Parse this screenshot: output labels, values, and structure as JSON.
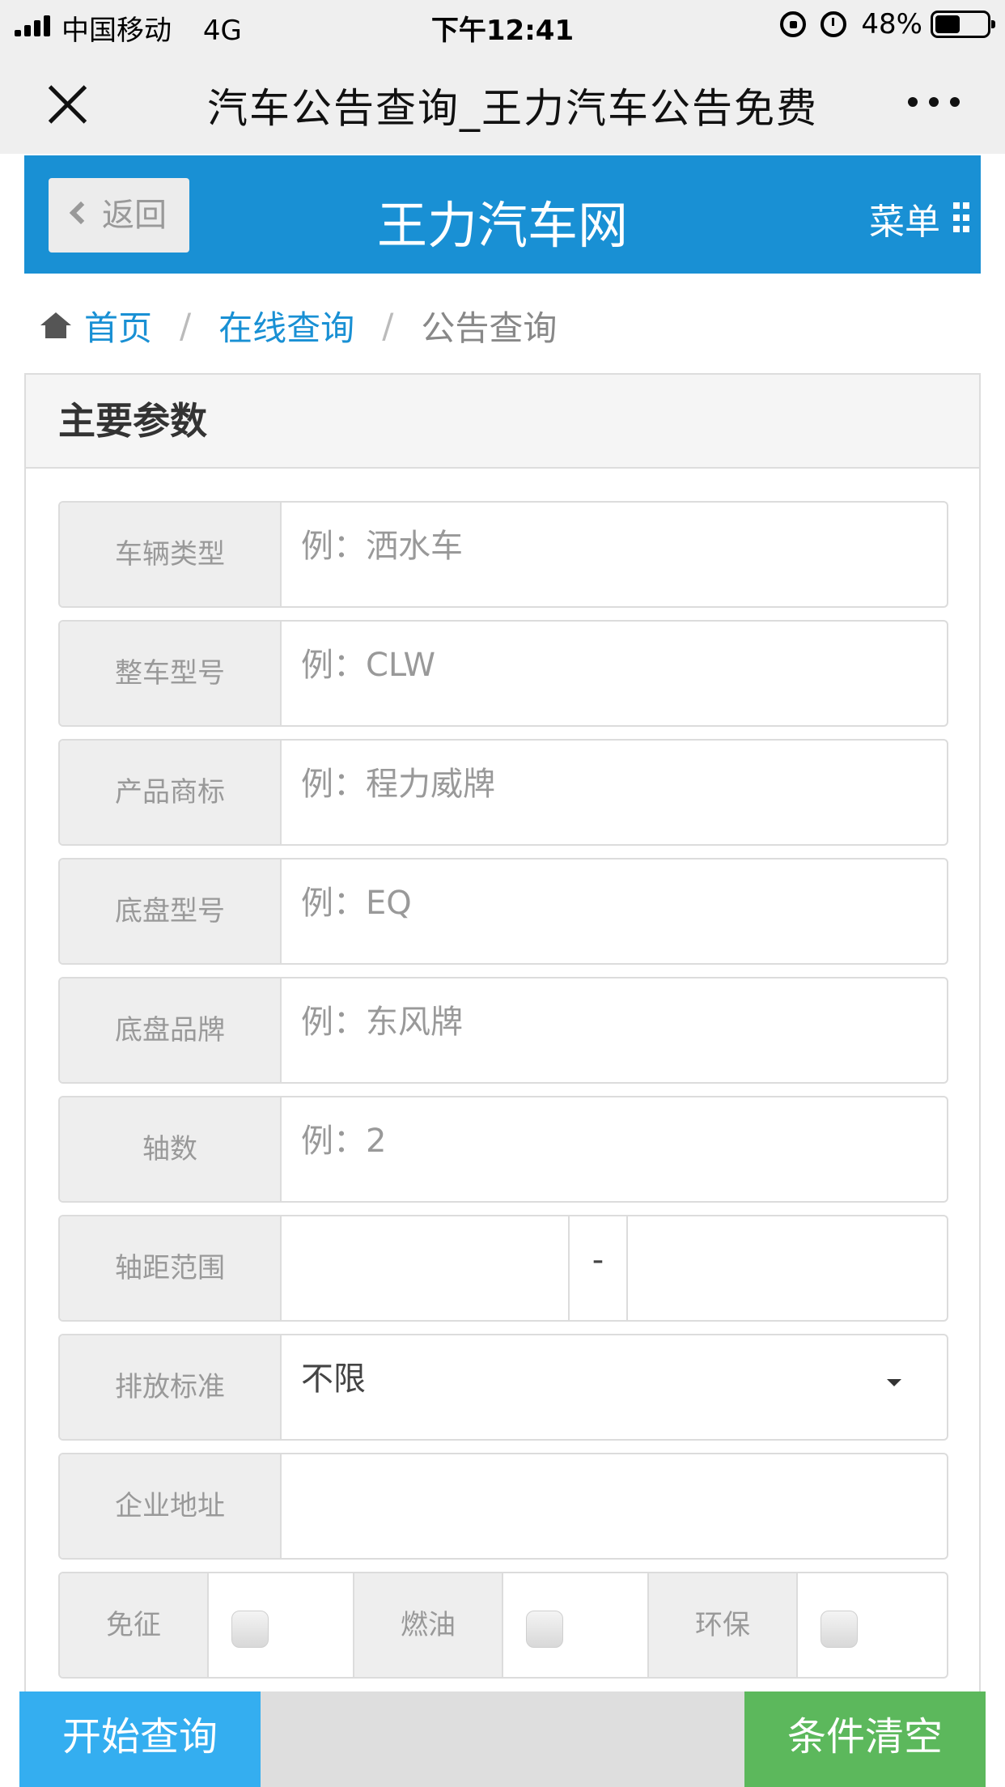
{
  "status_bar": {
    "carrier": "中国移动",
    "network": "4G",
    "time": "下午12:41",
    "battery": "48%",
    "battery_level": 0.48
  },
  "nav": {
    "title": "汽车公告查询_王力汽车公告免费",
    "close_icon": "close-icon",
    "more_icon": "more-icon"
  },
  "header": {
    "back_label": "返回",
    "site_title": "王力汽车网",
    "menu_label": "菜单",
    "brand_color": "#1990d4"
  },
  "breadcrumb": {
    "home": "首页",
    "level2": "在线查询",
    "current": "公告查询",
    "sep": "/"
  },
  "panel": {
    "heading": "主要参数",
    "fields": [
      {
        "label": "车辆类型",
        "placeholder": "例：洒水车"
      },
      {
        "label": "整车型号",
        "placeholder": "例：CLW"
      },
      {
        "label": "产品商标",
        "placeholder": "例：程力威牌"
      },
      {
        "label": "底盘型号",
        "placeholder": "例：EQ"
      },
      {
        "label": "底盘品牌",
        "placeholder": "例：东风牌"
      },
      {
        "label": "轴数",
        "placeholder": "例：2"
      }
    ],
    "wheelbase": {
      "label": "轴距范围",
      "sep": "-"
    },
    "emission": {
      "label": "排放标准",
      "value": "不限"
    },
    "address": {
      "label": "企业地址"
    },
    "checks": [
      "免征",
      "燃油",
      "环保"
    ]
  },
  "bottom": {
    "search_label": "开始查询",
    "clear_label": "条件清空",
    "search_color": "#34aef0",
    "clear_color": "#5cb85c"
  }
}
